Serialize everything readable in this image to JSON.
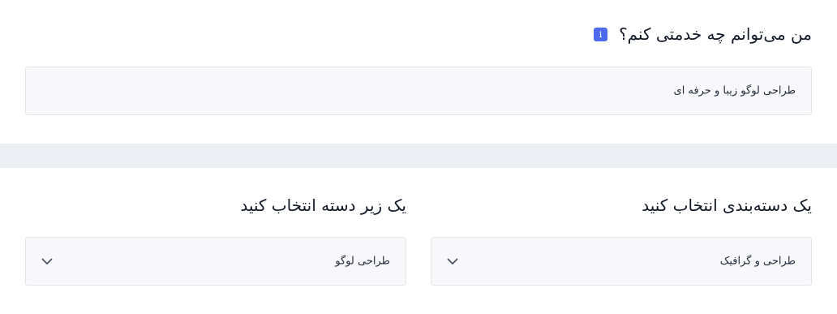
{
  "service": {
    "title": "من می‌توانم چه خدمتی کنم؟",
    "info_icon": "i",
    "value": "طراحی لوگو زیبا و حرفه ای"
  },
  "category": {
    "label": "یک دسته‌بندی انتخاب کنید",
    "selected": "طراحی و گرافیک"
  },
  "subcategory": {
    "label": "یک زیر دسته انتخاب کنید",
    "selected": "طراحی لوگو"
  },
  "colors": {
    "accent": "#4f6bed",
    "field_bg": "#f8f8fa",
    "field_border": "#e3e5ea",
    "band": "#eceff3"
  }
}
